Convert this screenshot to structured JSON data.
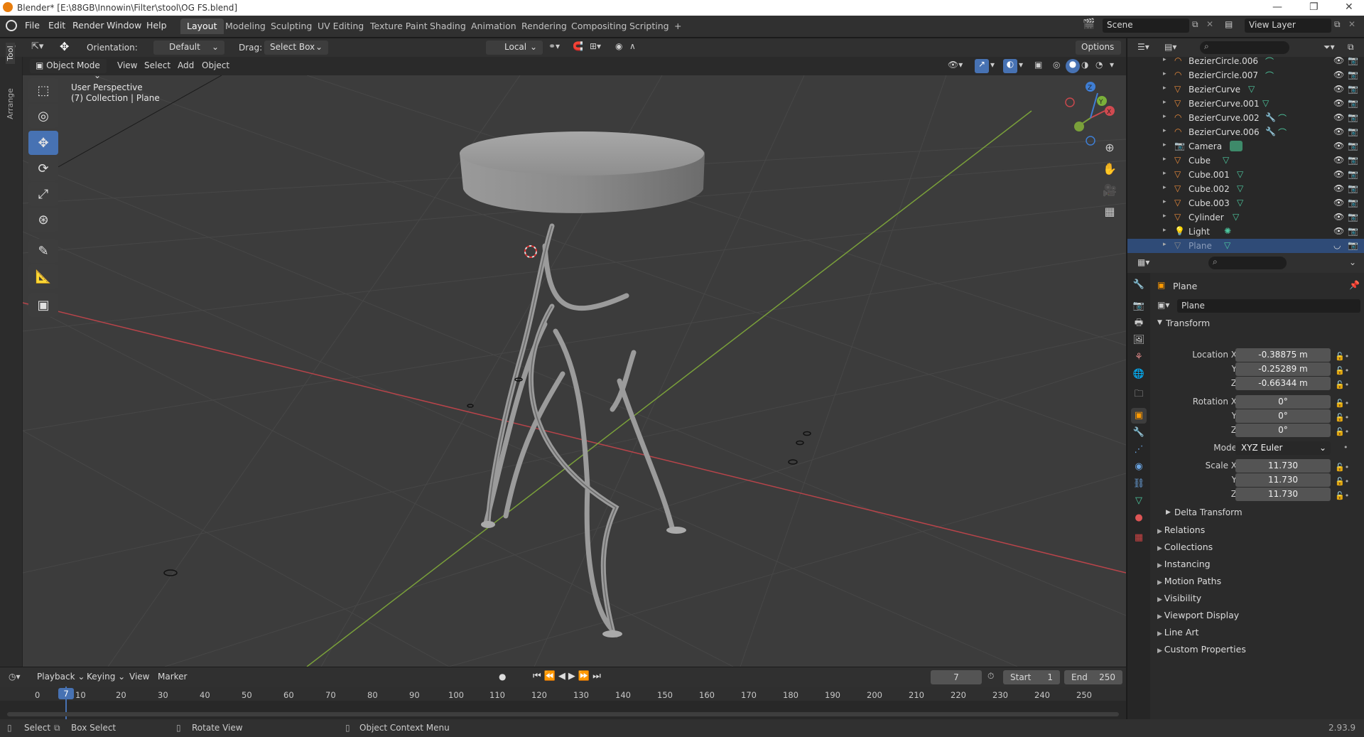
{
  "window": {
    "title": "Blender* [E:\\88GB\\Innowin\\Filter\\stool\\OG FS.blend]"
  },
  "menu": [
    "File",
    "Edit",
    "Render",
    "Window",
    "Help"
  ],
  "workspaces": [
    "Layout",
    "Modeling",
    "Sculpting",
    "UV Editing",
    "Texture Paint",
    "Shading",
    "Animation",
    "Rendering",
    "Compositing",
    "Scripting",
    "+"
  ],
  "scene": {
    "label": "Scene",
    "view_layer": "View Layer"
  },
  "toolheader": {
    "orientation_label": "Orientation:",
    "orientation_value": "Default",
    "drag_label": "Drag:",
    "drag_value": "Select Box",
    "transform_space": "Local",
    "options": "Options"
  },
  "viewport_header": {
    "mode": "Object Mode",
    "menus": [
      "View",
      "Select",
      "Add",
      "Object"
    ]
  },
  "viewport": {
    "line1": "User Perspective",
    "line2": "(7) Collection | Plane"
  },
  "left_tabs": [
    "Tool",
    "Arrange"
  ],
  "outliner": {
    "items": [
      {
        "name": "BezierCircle.006",
        "icon": "curve-icon",
        "selected": false
      },
      {
        "name": "BezierCircle.007",
        "icon": "curve-icon",
        "selected": false
      },
      {
        "name": "BezierCurve",
        "icon": "mesh-icon",
        "selected": false
      },
      {
        "name": "BezierCurve.001",
        "icon": "mesh-icon",
        "selected": false
      },
      {
        "name": "BezierCurve.002",
        "icon": "curve-icon",
        "selected": false
      },
      {
        "name": "BezierCurve.006",
        "icon": "curve-icon",
        "selected": false
      },
      {
        "name": "Camera",
        "icon": "camera-icon",
        "selected": false
      },
      {
        "name": "Cube",
        "icon": "mesh-icon",
        "selected": false
      },
      {
        "name": "Cube.001",
        "icon": "mesh-icon",
        "selected": false
      },
      {
        "name": "Cube.002",
        "icon": "mesh-icon",
        "selected": false
      },
      {
        "name": "Cube.003",
        "icon": "mesh-icon",
        "selected": false
      },
      {
        "name": "Cylinder",
        "icon": "mesh-icon",
        "selected": false
      },
      {
        "name": "Light",
        "icon": "light-icon",
        "selected": false
      },
      {
        "name": "Plane",
        "icon": "mesh-icon",
        "selected": true
      }
    ]
  },
  "properties": {
    "object_name": "Plane",
    "datablock": "Plane",
    "transform_title": "Transform",
    "location_label": "Location X",
    "location": [
      "-0.38875 m",
      "-0.25289 m",
      "-0.66344 m"
    ],
    "rotation_label": "Rotation X",
    "rotation": [
      "0°",
      "0°",
      "0°"
    ],
    "axis_y": "Y",
    "axis_z": "Z",
    "mode_label": "Mode",
    "mode_value": "XYZ Euler",
    "scale_label": "Scale X",
    "scale": [
      "11.730",
      "11.730",
      "11.730"
    ],
    "delta": "Delta Transform",
    "sections": [
      "Relations",
      "Collections",
      "Instancing",
      "Motion Paths",
      "Visibility",
      "Viewport Display",
      "Line Art",
      "Custom Properties"
    ]
  },
  "timeline": {
    "menus": [
      "Playback",
      "Keying",
      "View",
      "Marker"
    ],
    "current_frame": "7",
    "start_label": "Start",
    "start": "1",
    "end_label": "End",
    "end": "250",
    "ticks": [
      "0",
      "10",
      "20",
      "30",
      "40",
      "50",
      "60",
      "70",
      "80",
      "90",
      "100",
      "110",
      "120",
      "130",
      "140",
      "150",
      "160",
      "170",
      "180",
      "190",
      "200",
      "210",
      "220",
      "230",
      "240",
      "250"
    ]
  },
  "statusbar": {
    "select": "Select",
    "box_select": "Box Select",
    "rotate": "Rotate View",
    "context": "Object Context Menu",
    "version": "2.93.9"
  },
  "colors": {
    "accent": "#4772b3",
    "x_axis": "#c8484d",
    "y_axis": "#7aa03a",
    "z_axis": "#3f7ed4"
  }
}
